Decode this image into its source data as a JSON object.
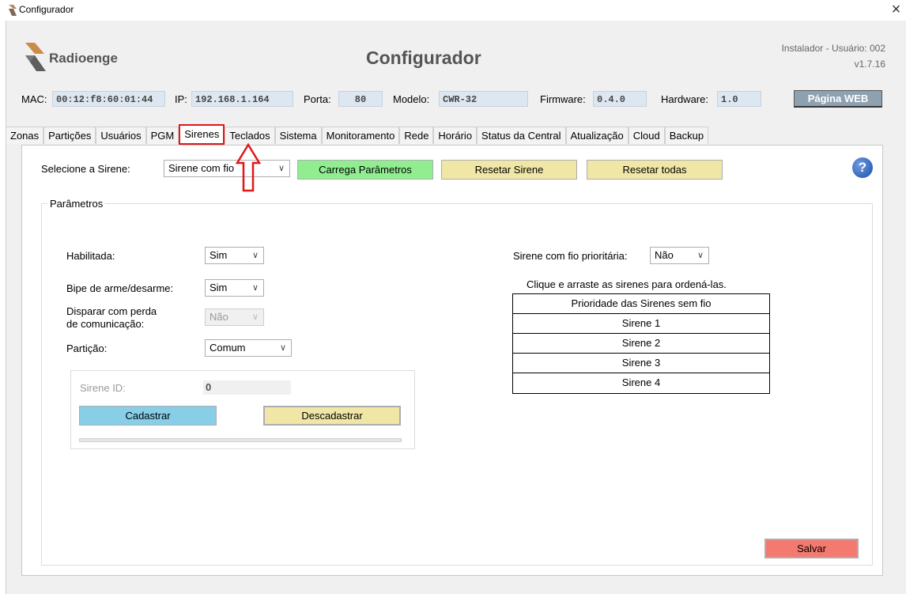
{
  "window": {
    "title": "Configurador",
    "close_glyph": "×"
  },
  "header": {
    "brand": "Radioenge",
    "app_title": "Configurador",
    "user": "Instalador - Usuário:  002",
    "version": "v1.7.16"
  },
  "info": {
    "mac_label": "MAC:",
    "mac": "00:12:f8:60:01:44",
    "ip_label": "IP:",
    "ip": "192.168.1.164",
    "porta_label": "Porta:",
    "porta": "80",
    "modelo_label": "Modelo:",
    "modelo": "CWR-32",
    "firmware_label": "Firmware:",
    "firmware": "0.4.0",
    "hardware_label": "Hardware:",
    "hardware": "1.0",
    "web_button": "Página WEB"
  },
  "tabs": [
    "Zonas",
    "Partições",
    "Usuários",
    "PGM",
    "Sirenes",
    "Teclados",
    "Sistema",
    "Monitoramento",
    "Rede",
    "Horário",
    "Status da Central",
    "Atualização",
    "Cloud",
    "Backup"
  ],
  "active_tab": "Sirenes",
  "toolbar": {
    "select_label": "Selecione a Sirene:",
    "select_value": "Sirene com fio",
    "load_button": "Carrega Parâmetros",
    "reset_button": "Resetar Sirene",
    "reset_all_button": "Resetar todas",
    "help_glyph": "?"
  },
  "params": {
    "group_title": "Parâmetros",
    "habilitada_label": "Habilitada:",
    "habilitada_value": "Sim",
    "bipe_label": "Bipe de arme/desarme:",
    "bipe_value": "Sim",
    "disparar_label_1": "Disparar com perda",
    "disparar_label_2": "de comunicação:",
    "disparar_value": "Não",
    "particao_label": "Partição:",
    "particao_value": "Comum",
    "sirene_id_label": "Sirene ID:",
    "sirene_id_value": "0",
    "cadastrar_button": "Cadastrar",
    "descadastrar_button": "Descadastrar",
    "prioritaria_label": "Sirene com fio prioritária:",
    "prioritaria_value": "Não",
    "drag_hint": "Clique e arraste as sirenes para ordená-las.",
    "table_header": "Prioridade das Sirenes sem fio",
    "table_rows": [
      "Sirene 1",
      "Sirene 2",
      "Sirene 3",
      "Sirene 4"
    ],
    "save_button": "Salvar"
  },
  "colors": {
    "active_tab_border": "#e01818",
    "green_button": "#90ee90",
    "yellow_button": "#f0e6a6",
    "blue_button": "#87cee6",
    "red_button": "#f47a70",
    "web_button": "#8ea1b0",
    "info_field": "#dde7f1"
  }
}
